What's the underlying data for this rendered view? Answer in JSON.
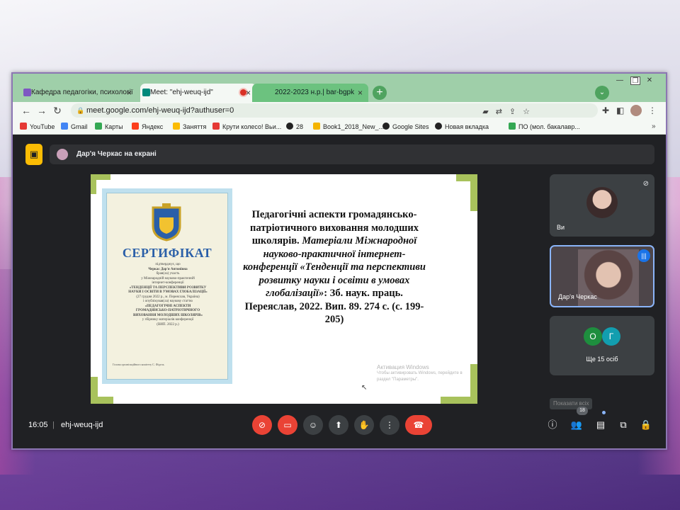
{
  "browser": {
    "tabs": [
      {
        "title": "Кафедра педагогіки, психології",
        "close": "×"
      },
      {
        "title": "Meet: \"ehj-weuq-ijd\"",
        "close": "×"
      },
      {
        "title": "2022-2023 н.р.| bar-bgpk",
        "close": "×"
      }
    ],
    "new_tab": "+",
    "tab_menu": "⌄",
    "window_controls": {
      "minimize": "—",
      "maximize": "❐",
      "close": "✕"
    },
    "url": "meet.google.com/ehj-weuq-ijd?authuser=0",
    "bookmarks": [
      {
        "label": "YouTube",
        "color": "#e53935"
      },
      {
        "label": "Gmail",
        "color": "#4285f4"
      },
      {
        "label": "Карты",
        "color": "#34a853"
      },
      {
        "label": "Яндекс",
        "color": "#fc3f1d"
      },
      {
        "label": "Заняття",
        "color": "#fbbc04"
      },
      {
        "label": "Крути колесо! Вьи...",
        "color": "#e53935"
      },
      {
        "label": "28",
        "color": "#222222"
      },
      {
        "label": "Book1_2018_New_...",
        "color": "#f4b400"
      },
      {
        "label": "Google Sites",
        "color": "#222222"
      },
      {
        "label": "Новая вкладка",
        "color": "#222222"
      },
      {
        "label": "ПО (мол. бакалавр...",
        "color": "#34a853"
      }
    ],
    "bookmarks_more": "»"
  },
  "meet": {
    "presenter_banner": "Дар'я Черкас на екрані",
    "slide": {
      "certificate": {
        "title": "СЕРТИФІКАТ",
        "lines": [
          {
            "text": "підтверджує, що",
            "bold": false
          },
          {
            "text": "Черкас Дар'я Антонівна",
            "bold": true
          },
          {
            "text": "брав(ла) участь",
            "bold": false
          },
          {
            "text": "у Міжнародній науково-практичній",
            "bold": false
          },
          {
            "text": "інтернет-конференції",
            "bold": false
          },
          {
            "text": "«ТЕНДЕНЦІЇ ТА ПЕРСПЕКТИВИ РОЗВИТКУ",
            "bold": true
          },
          {
            "text": "НАУКИ І ОСВІТИ В УМОВАХ ГЛОБАЛІЗАЦІЇ»",
            "bold": true
          },
          {
            "text": "(27 грудня 2022 р., м. Переяслав, Україна)",
            "bold": false
          },
          {
            "text": "і опублікував(ла) наукову статтю",
            "bold": false
          },
          {
            "text": "«ПЕДАГОГІЧНІ АСПЕКТИ",
            "bold": true
          },
          {
            "text": "ГРОМАДЯНСЬКО-ПАТРІОТИЧНОГО",
            "bold": true
          },
          {
            "text": "ВИХОВАННЯ МОЛОДШИХ ШКОЛЯРІВ»",
            "bold": true
          },
          {
            "text": "у збірнику матеріалів конференції",
            "bold": false
          },
          {
            "text": "(ВИП. 2022 р.)",
            "bold": false
          }
        ],
        "footer": "Голова організаційного комітету          С. Фідель"
      },
      "text_bold": "Педагогічні аспекти громадянсько-патріотичного виховання молодших школярів.",
      "text_italic": " Матеріали Міжнародної науково-практичної інтернет-конференції «Тенденції та перспективи розвитку науки і освіти в умовах глобалізації»",
      "text_tail": ": Зб. наук. праць. Переяслав, 2022. Вип. 89. 274 с. (с. 199-205)",
      "watermark_title": "Активация Windows",
      "watermark_sub": "Чтобы активировать Windows, перейдите в раздел \"Параметры\"."
    },
    "tiles": [
      {
        "name": "Ви"
      },
      {
        "name": "Дар'я Черкас"
      },
      {
        "bubbles": [
          "О",
          "Г"
        ],
        "label": "Ще 15 осіб"
      }
    ],
    "bottom": {
      "time": "16:05",
      "separator": "|",
      "code": "ehj-weuq-ijd",
      "show_all_tooltip": "Показати всіх",
      "participant_count": "18"
    }
  }
}
